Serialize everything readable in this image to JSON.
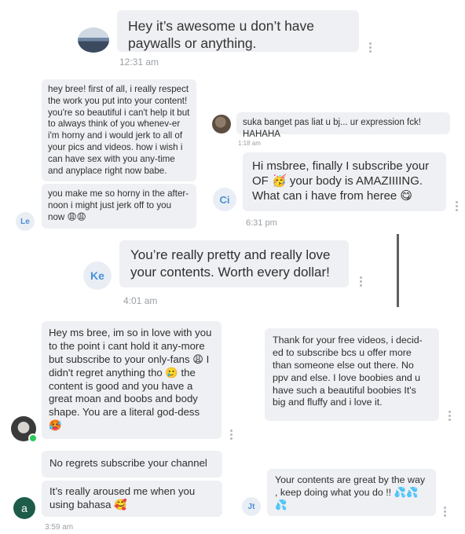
{
  "chat1": {
    "message": "Hey it’s awesome u don’t have paywalls or anything.",
    "time": "12:31 am"
  },
  "chat2": {
    "message1": "hey bree! first of all, i really respect the work you put into your content! you're so beautiful i can't help it but to always think of you whenev-er i'm horny and i would jerk to all of your pics and videos. how i wish i can have sex with you any-time and anyplace right now babe.",
    "message2": "you make me so horny in the after-noon i might just jerk off to you now 😩😩",
    "avatar_initials": "Le"
  },
  "chat3": {
    "message": "suka banget pas liat u bj... ur expression fck! HAHAHA",
    "time": "1:18 am"
  },
  "chat4": {
    "message": "Hi msbree, finally I subscribe your OF 🥳 your body is AMAZIIIING. What can i have from heree 😋",
    "time": "6:31 pm",
    "avatar_initials": "Ci"
  },
  "chat5": {
    "message": "You’re really pretty and really love your contents. Worth every dollar!",
    "time": "4:01 am",
    "avatar_initials": "Ke"
  },
  "chat6": {
    "message": "Hey ms bree, im so in love with you to the point i cant hold it any-more but subscribe to your only-fans 😩 I didn't regret anything tho 🥲 the content is good and you have a great moan and boobs and body shape. You are a literal god-dess 🥵"
  },
  "chat7": {
    "message": "Thank for your free videos, i decid-ed to subscribe bcs u offer more than someone else out there. No ppv and else. I love boobies and u have such a beautiful boobies It's big and fluffy and i love it."
  },
  "chat8": {
    "message1": "No regrets subscribe your channel",
    "message2": "It’s really aroused me when you using bahasa 🥰",
    "time": "3:59 am",
    "avatar_initials": "a"
  },
  "chat9": {
    "message": "Your contents are great by the way , keep doing what you do !! 💦💦💦",
    "avatar_initials": "Jt"
  }
}
